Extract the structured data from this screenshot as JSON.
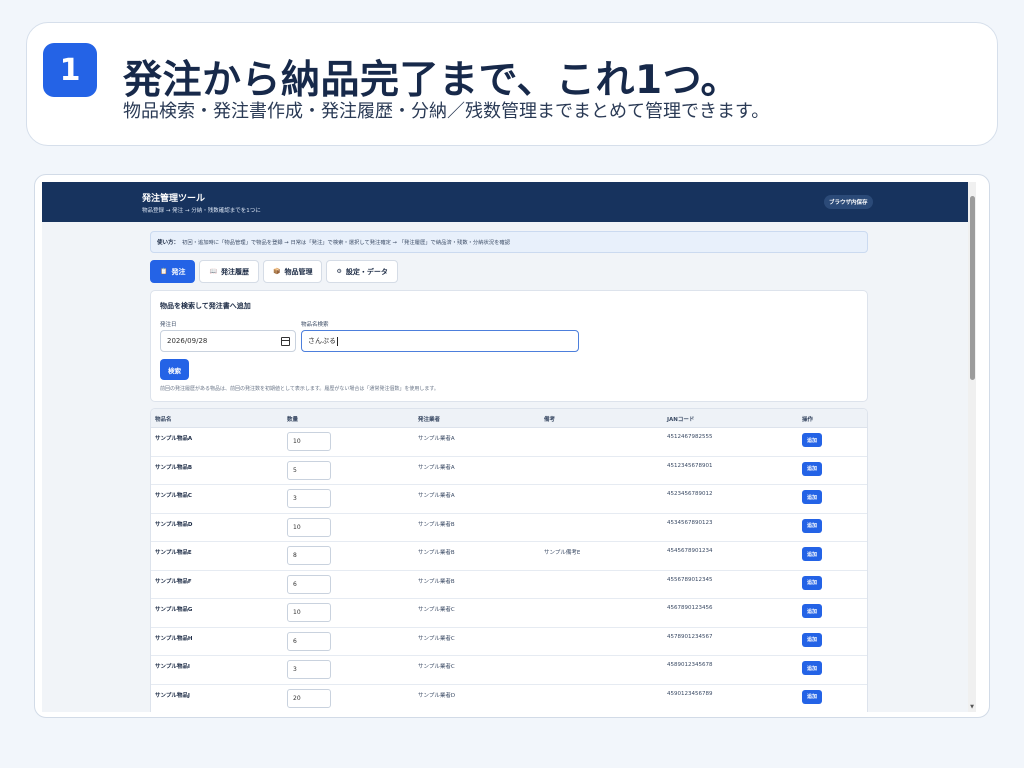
{
  "banner": {
    "number": "1",
    "title": "発注から納品完了まで、これ1つ。",
    "subtitle": "物品検索・発注書作成・発注履歴・分納／残数管理までまとめて管理できます。"
  },
  "app": {
    "title": "発注管理ツール",
    "subtitle": "物品登録 → 発注 → 分納・残数確認までを1つに",
    "storage_badge": "ブラウザ内保存",
    "usage_label": "使い方：",
    "usage_text": "初回・追加時に「物品管理」で物品を登録 → 日常は「発注」で検索・選択して発注確定 → 「発注履歴」で納品済・残数・分納状況を確認"
  },
  "tabs": [
    {
      "icon": "📋",
      "label": "発注",
      "active": true
    },
    {
      "icon": "📖",
      "label": "発注履歴",
      "active": false
    },
    {
      "icon": "📦",
      "label": "物品管理",
      "active": false
    },
    {
      "icon": "⚙",
      "label": "設定・データ",
      "active": false
    }
  ],
  "search": {
    "card_title": "物品を検索して発注書へ追加",
    "date_label": "発注日",
    "date_value": "2026/09/28",
    "name_label": "物品名検索",
    "name_value": "さんぷる",
    "button_label": "検索",
    "note": "前回の発注履歴がある物品は、前回の発注数を初期値として表示します。履歴がない場合は「通常発注個数」を使用します。"
  },
  "table": {
    "headers": {
      "name": "物品名",
      "qty": "数量",
      "vendor": "発注業者",
      "remarks": "備考",
      "jan": "JANコード",
      "action": "操作"
    },
    "rows": [
      {
        "name": "サンプル物品A",
        "qty": "10",
        "vendor": "サンプル業者A",
        "remarks": "",
        "jan": "4512467982555",
        "action": "追加"
      },
      {
        "name": "サンプル物品B",
        "qty": "5",
        "vendor": "サンプル業者A",
        "remarks": "",
        "jan": "4512345678901",
        "action": "追加"
      },
      {
        "name": "サンプル物品C",
        "qty": "3",
        "vendor": "サンプル業者A",
        "remarks": "",
        "jan": "4523456789012",
        "action": "追加"
      },
      {
        "name": "サンプル物品D",
        "qty": "10",
        "vendor": "サンプル業者B",
        "remarks": "",
        "jan": "4534567890123",
        "action": "追加"
      },
      {
        "name": "サンプル物品E",
        "qty": "8",
        "vendor": "サンプル業者B",
        "remarks": "サンプル備考E",
        "jan": "4545678901234",
        "action": "追加"
      },
      {
        "name": "サンプル物品F",
        "qty": "6",
        "vendor": "サンプル業者B",
        "remarks": "",
        "jan": "4556789012345",
        "action": "追加"
      },
      {
        "name": "サンプル物品G",
        "qty": "10",
        "vendor": "サンプル業者C",
        "remarks": "",
        "jan": "4567890123456",
        "action": "追加"
      },
      {
        "name": "サンプル物品H",
        "qty": "6",
        "vendor": "サンプル業者C",
        "remarks": "",
        "jan": "4578901234567",
        "action": "追加"
      },
      {
        "name": "サンプル物品I",
        "qty": "3",
        "vendor": "サンプル業者C",
        "remarks": "",
        "jan": "4589012345678",
        "action": "追加"
      },
      {
        "name": "サンプル物品J",
        "qty": "20",
        "vendor": "サンプル業者D",
        "remarks": "",
        "jan": "4590123456789",
        "action": "追加"
      }
    ]
  },
  "colors": {
    "accent": "#2463e6",
    "header": "#17335e"
  }
}
